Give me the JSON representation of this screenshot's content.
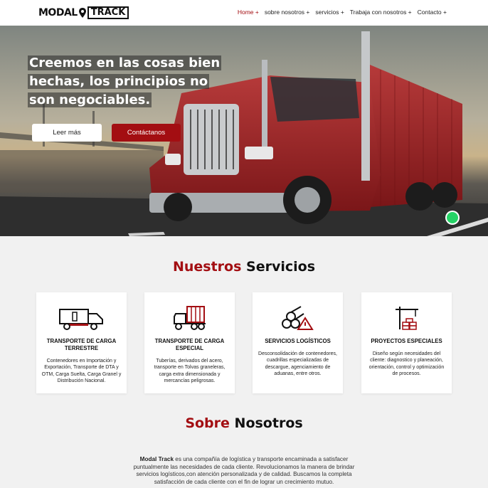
{
  "header": {
    "logo_left": "MODAL",
    "logo_right": "TRACK",
    "nav": [
      "Home +",
      "sobre nosotros +",
      "servicios +",
      "Trabaja con nosotros +",
      "Contacto +"
    ]
  },
  "hero": {
    "title_lines": [
      "Creemos en las cosas bien",
      "hechas, los principios no",
      "son negociables."
    ],
    "btn_more": "Leer más",
    "btn_contact": "Contáctanos"
  },
  "services": {
    "title_accent": "Nuestros",
    "title_rest": "Servicios",
    "cards": [
      {
        "title": "TRANSPORTE DE CARGA TERRESTRE",
        "desc": "Contenedores en Importación y Exportación, Transporte de DTA y OTM, Carga Suelta, Carga Granel y Distribución Nacional."
      },
      {
        "title": "TRANSPORTE DE CARGA ESPECIAL",
        "desc": "Tuberías, derivados del acero, transporte en Tolvas graneleras, carga extra dimensionada y mercancías peligrosas."
      },
      {
        "title": "SERVICIOS LOGÍSTICOS",
        "desc": "Desconsolidación de contenedores, cuadrillas especializadas de descargue, agenciamiento de aduanas, entre otros."
      },
      {
        "title": "PROYECTOS ESPECIALES",
        "desc": "Diseño según necesidades del cliente: diagnostico y planeación, orientación, control y optimización de procesos."
      }
    ]
  },
  "about": {
    "title_accent": "Sobre",
    "title_rest": "Nosotros",
    "brand": "Modal Track",
    "text": " es una compañía de logística y transporte encaminada a satisfacer puntualmente las necesidades de cada cliente. Revolucionamos la manera de brindar servicios logísticos,con atención personalizada y de calidad. Buscamos la completa satisfacción de cada cliente con el fin de lograr un crecimiento mutuo."
  },
  "colors": {
    "accent": "#a30e12",
    "whatsapp": "#25d366"
  }
}
